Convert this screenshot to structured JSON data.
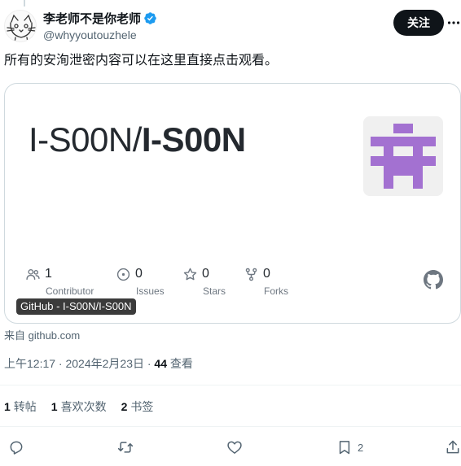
{
  "user": {
    "display_name": "李老师不是你老师",
    "handle": "@whyyoutouzhele",
    "follow_label": "关注"
  },
  "tweet": {
    "text": "所有的安洵泄密内容可以在这里直接点击观看。"
  },
  "card": {
    "repo_owner": "I-S00N/",
    "repo_name": "I-S00N",
    "stats": [
      {
        "icon": "people-icon",
        "value": "1",
        "label": "Contributor"
      },
      {
        "icon": "issue-icon",
        "value": "0",
        "label": "Issues"
      },
      {
        "icon": "star-icon",
        "value": "0",
        "label": "Stars"
      },
      {
        "icon": "fork-icon",
        "value": "0",
        "label": "Forks"
      }
    ],
    "badge": "GitHub - I-S00N/I-S00N",
    "source": "来自 github.com",
    "avatar_color": "#a371d1"
  },
  "meta": {
    "time": "上午12:17 · 2024年2月23日 · ",
    "views_count": "44",
    "views_label": " 查看"
  },
  "engagement": {
    "retweets_count": "1",
    "retweets_label": "转帖",
    "likes_count": "1",
    "likes_label": "喜欢次数",
    "bookmarks_count": "2",
    "bookmarks_label": "书签"
  },
  "actions": {
    "bookmark_count": "2"
  },
  "colors": {
    "verified": "#1d9bf0",
    "text_secondary": "#536471"
  }
}
